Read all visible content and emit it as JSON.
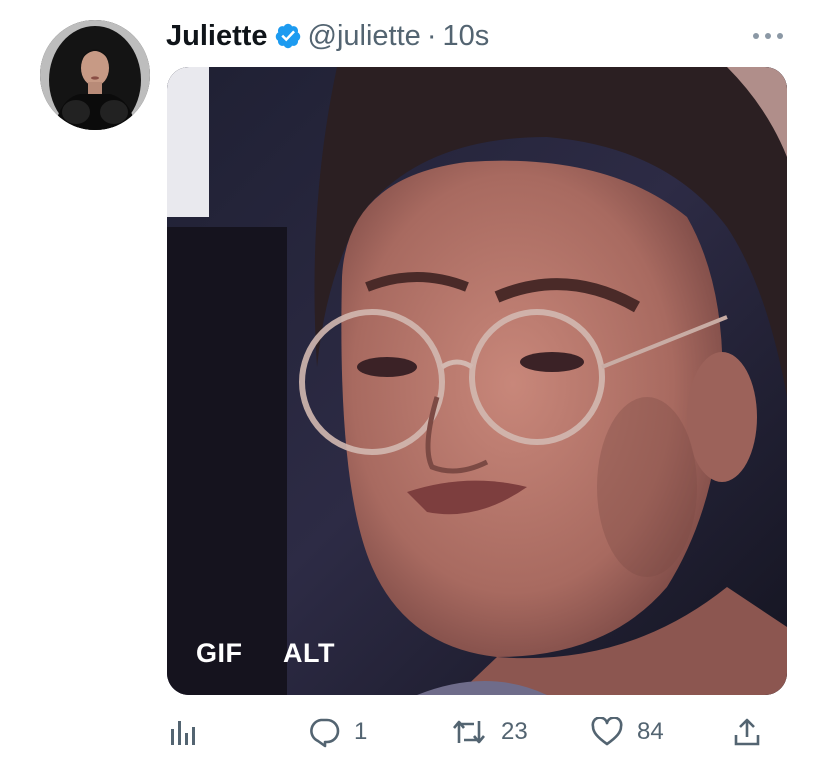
{
  "tweet": {
    "author": {
      "display_name": "Juliette",
      "handle": "@juliette",
      "verified": true,
      "avatar_icon": "profile-photo"
    },
    "separator": "·",
    "timestamp": "10s",
    "more_icon": "ellipsis-icon",
    "media": {
      "type": "gif",
      "gif_label": "GIF",
      "alt_label": "ALT"
    },
    "actions": {
      "analytics_icon": "analytics-icon",
      "reply_count": "1",
      "retweet_count": "23",
      "like_count": "84",
      "share_icon": "share-icon"
    }
  },
  "colors": {
    "text_primary": "#0f1419",
    "text_secondary": "#536471",
    "verified_blue": "#1d9bf0"
  }
}
